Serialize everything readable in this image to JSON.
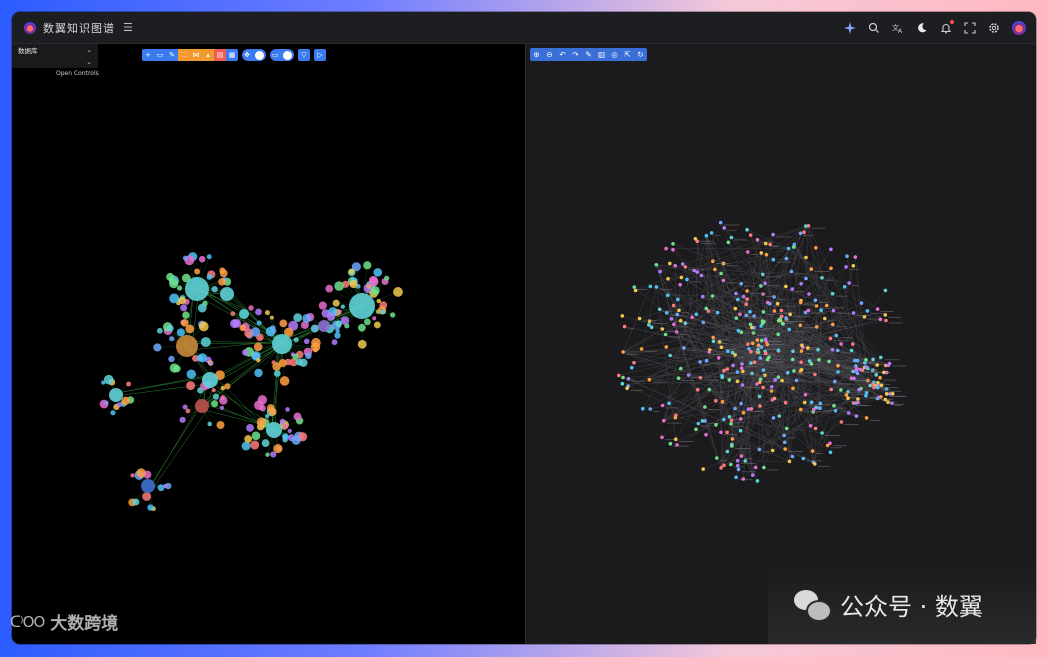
{
  "app": {
    "title": "数翼知识图谱"
  },
  "left_panel": {
    "database_label": "数据库",
    "database_value": "",
    "open_controls": "Open Controls"
  },
  "toolbar_left": {
    "buttons": [
      "add-icon",
      "folder-icon",
      "edit-icon",
      "select-icon",
      "share-icon",
      "lock-icon",
      "delete-icon",
      "grid-icon"
    ],
    "toggles": [
      "move-toggle",
      "filter-toggle"
    ],
    "extra": [
      "funnel-icon",
      "play-icon"
    ]
  },
  "toolbar_right": {
    "buttons": [
      "zoom-in-icon",
      "zoom-out-icon",
      "undo-icon",
      "redo-icon",
      "edit-icon",
      "delete-icon",
      "locate-icon",
      "export-icon",
      "refresh-icon"
    ]
  },
  "header_icons": [
    "sparkle-icon",
    "search-icon",
    "translate-icon",
    "moon-icon",
    "bell-icon",
    "fullscreen-icon",
    "settings-icon",
    "avatar"
  ],
  "watermarks": {
    "left": "大数跨境",
    "right": "公众号 · 数翼"
  },
  "colors": {
    "accent": "#3b7bf0",
    "orange": "#f29a2e",
    "red": "#f25c54",
    "edge_green": "#3fbf4a",
    "node_cyan": "#5fd3d8"
  }
}
